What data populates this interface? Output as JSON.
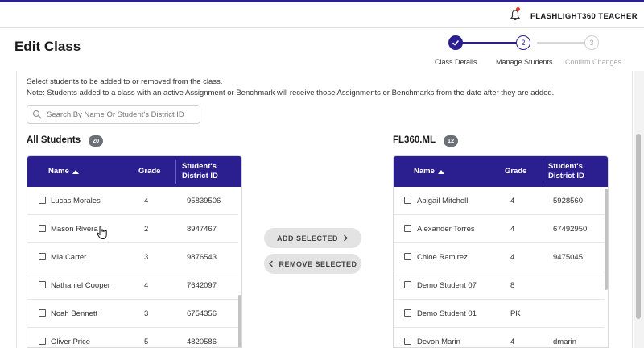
{
  "app": {
    "username": "FLASHLIGHT360 TEACHER"
  },
  "page": {
    "title": "Edit Class"
  },
  "stepper": {
    "steps": [
      {
        "number": "1",
        "label": "Class Details",
        "state": "completed"
      },
      {
        "number": "2",
        "label": "Manage Students",
        "state": "current"
      },
      {
        "number": "3",
        "label": "Confirm Changes",
        "state": "upcoming"
      }
    ]
  },
  "instructions": {
    "line1": "Select students to be added to or removed from the class.",
    "line2": "Note: Students added to a class with an active Assignment or Benchmark will receive those Assignments or Benchmarks from the date after they are added."
  },
  "search": {
    "value": "",
    "placeholder": "Search By Name Or Student's District ID"
  },
  "all_students": {
    "title": "All Students",
    "count": "20",
    "columns": {
      "name": "Name",
      "grade": "Grade",
      "district_id": "Student's District ID"
    },
    "rows": [
      {
        "name": "Lucas Morales",
        "grade": "4",
        "district_id": "95839506"
      },
      {
        "name": "Mason Rivera",
        "grade": "2",
        "district_id": "8947467"
      },
      {
        "name": "Mia Carter",
        "grade": "3",
        "district_id": "9876543"
      },
      {
        "name": "Nathaniel Cooper",
        "grade": "4",
        "district_id": "7642097"
      },
      {
        "name": "Noah Bennett",
        "grade": "3",
        "district_id": "6754356"
      },
      {
        "name": "Oliver Price",
        "grade": "5",
        "district_id": "4820586"
      }
    ]
  },
  "class_students": {
    "title": "FL360.ML",
    "count": "12",
    "columns": {
      "name": "Name",
      "grade": "Grade",
      "district_id": "Student's District ID"
    },
    "rows": [
      {
        "name": "Abigail Mitchell",
        "grade": "4",
        "district_id": "5928560"
      },
      {
        "name": "Alexander Torres",
        "grade": "4",
        "district_id": "67492950"
      },
      {
        "name": "Chloe Ramirez",
        "grade": "4",
        "district_id": "9475045"
      },
      {
        "name": "Demo Student 07",
        "grade": "8",
        "district_id": ""
      },
      {
        "name": "Demo Student 01",
        "grade": "PK",
        "district_id": ""
      },
      {
        "name": "Devon Marin",
        "grade": "4",
        "district_id": "dmarin"
      }
    ]
  },
  "actions": {
    "add_label": "ADD SELECTED",
    "remove_label": "REMOVE SELECTED"
  },
  "colors": {
    "brand": "#2b1f8f",
    "badge": "#6b6f76",
    "notification": "#e0352b"
  },
  "icons": [
    "bell-icon",
    "search-icon",
    "check-icon",
    "sort-up-icon",
    "chevron-right-icon",
    "chevron-left-icon",
    "hand-cursor-icon"
  ]
}
